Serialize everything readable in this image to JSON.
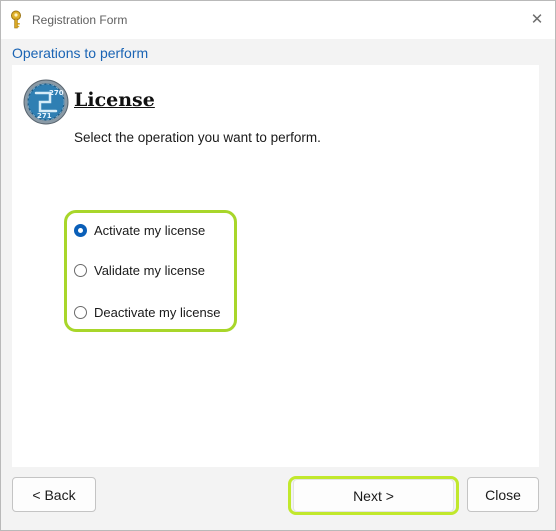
{
  "window": {
    "title": "Registration Form",
    "close_symbol": "✕"
  },
  "section_header": "Operations to perform",
  "logo": {
    "top_text": "270",
    "bottom_text": "271"
  },
  "page": {
    "heading": "License",
    "instruction": "Select the operation you want to perform."
  },
  "options": [
    {
      "label": "Activate my license",
      "selected": true
    },
    {
      "label": "Validate my license",
      "selected": false
    },
    {
      "label": "Deactivate my license",
      "selected": false
    }
  ],
  "buttons": {
    "back": "< Back",
    "next": "Next >",
    "close": "Close"
  },
  "colors": {
    "highlight": "#b5dd2a",
    "link_blue": "#1a64b4",
    "radio_blue": "#0a5fb8"
  }
}
